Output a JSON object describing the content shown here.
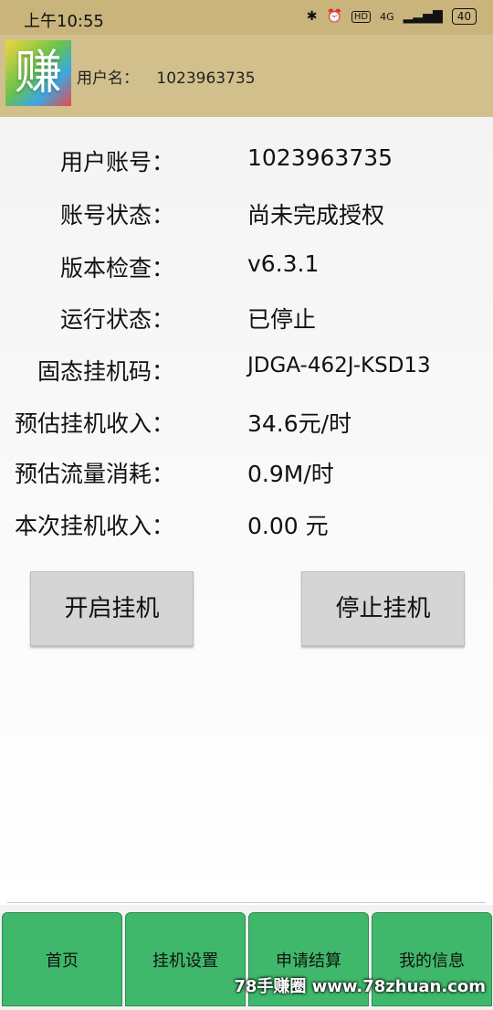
{
  "status_bar": {
    "time": "上午10:55",
    "icons": [
      "bluetooth-icon",
      "alarm-icon",
      "hd-icon",
      "signal-icon"
    ],
    "network": "4G",
    "battery": "40"
  },
  "header": {
    "app_icon_char": "赚",
    "user_label": "用户名：",
    "user_value": "1023963735"
  },
  "info": [
    {
      "label": "用户账号：",
      "value": "1023963735"
    },
    {
      "label": "账号状态：",
      "value": "尚未完成授权"
    },
    {
      "label": "版本检查：",
      "value": "v6.3.1"
    },
    {
      "label": "运行状态：",
      "value": "已停止"
    },
    {
      "label": "固态挂机码：",
      "value": "JDGA-462J-KSD13"
    },
    {
      "label": "预估挂机收入：",
      "value": "34.6元/时"
    },
    {
      "label": "预估流量消耗：",
      "value": "0.9M/时"
    },
    {
      "label": "本次挂机收入：",
      "value": "0.00 元"
    }
  ],
  "buttons": {
    "start": "开启挂机",
    "stop": "停止挂机"
  },
  "nav": [
    "首页",
    "挂机设置",
    "申请结算",
    "我的信息"
  ],
  "watermark": "78手赚圈 www.78zhuan.com"
}
